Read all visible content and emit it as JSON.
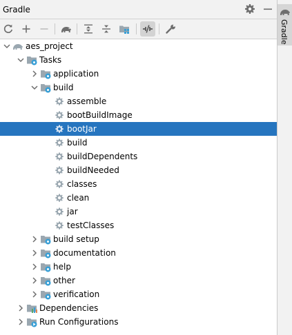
{
  "panel": {
    "title": "Gradle",
    "header_icons": [
      "gear-icon",
      "minimize-icon"
    ],
    "toolbar": [
      {
        "name": "reload-all-gradle-projects-button",
        "icon": "refresh-icon"
      },
      {
        "name": "add-gradle-project-button",
        "icon": "plus-icon"
      },
      {
        "name": "remove-gradle-project-button",
        "icon": "minus-icon",
        "enabled": false
      },
      {
        "name": "execute-gradle-task-button",
        "icon": "gradle-elephant-icon"
      },
      {
        "name": "expand-all-button",
        "icon": "expand-all-icon"
      },
      {
        "name": "collapse-all-button",
        "icon": "collapse-all-icon"
      },
      {
        "name": "analyze-dependencies-button",
        "icon": "dependencies-icon"
      },
      {
        "name": "toggle-offline-mode-button",
        "icon": "offline-mode-icon",
        "toggled": true
      },
      {
        "name": "build-tool-settings-button",
        "icon": "wrench-icon"
      }
    ]
  },
  "tree": {
    "selected_index": 6,
    "rows": [
      {
        "label": "aes_project",
        "depth": 0,
        "arrow": "expanded",
        "icon": "gradle-project-icon"
      },
      {
        "label": "Tasks",
        "depth": 1,
        "arrow": "expanded",
        "icon": "tasks-folder-icon"
      },
      {
        "label": "application",
        "depth": 2,
        "arrow": "collapsed",
        "icon": "task-group-icon"
      },
      {
        "label": "build",
        "depth": 2,
        "arrow": "expanded",
        "icon": "task-group-icon"
      },
      {
        "label": "assemble",
        "depth": 3,
        "arrow": "none",
        "icon": "gear-icon"
      },
      {
        "label": "bootBuildImage",
        "depth": 3,
        "arrow": "none",
        "icon": "gear-icon"
      },
      {
        "label": "bootJar",
        "depth": 3,
        "arrow": "none",
        "icon": "gear-icon"
      },
      {
        "label": "build",
        "depth": 3,
        "arrow": "none",
        "icon": "gear-icon"
      },
      {
        "label": "buildDependents",
        "depth": 3,
        "arrow": "none",
        "icon": "gear-icon"
      },
      {
        "label": "buildNeeded",
        "depth": 3,
        "arrow": "none",
        "icon": "gear-icon"
      },
      {
        "label": "classes",
        "depth": 3,
        "arrow": "none",
        "icon": "gear-icon"
      },
      {
        "label": "clean",
        "depth": 3,
        "arrow": "none",
        "icon": "gear-icon"
      },
      {
        "label": "jar",
        "depth": 3,
        "arrow": "none",
        "icon": "gear-icon"
      },
      {
        "label": "testClasses",
        "depth": 3,
        "arrow": "none",
        "icon": "gear-icon"
      },
      {
        "label": "build setup",
        "depth": 2,
        "arrow": "collapsed",
        "icon": "task-group-icon"
      },
      {
        "label": "documentation",
        "depth": 2,
        "arrow": "collapsed",
        "icon": "task-group-icon"
      },
      {
        "label": "help",
        "depth": 2,
        "arrow": "collapsed",
        "icon": "task-group-icon"
      },
      {
        "label": "other",
        "depth": 2,
        "arrow": "collapsed",
        "icon": "task-group-icon"
      },
      {
        "label": "verification",
        "depth": 2,
        "arrow": "collapsed",
        "icon": "task-group-icon"
      },
      {
        "label": "Dependencies",
        "depth": 1,
        "arrow": "collapsed",
        "icon": "dependencies-folder-icon"
      },
      {
        "label": "Run Configurations",
        "depth": 1,
        "arrow": "collapsed",
        "icon": "run-configurations-folder-icon"
      }
    ]
  },
  "side_stripe": {
    "label": "Gradle",
    "icon": "gradle-elephant-icon"
  },
  "colors": {
    "selection": "#2675bf",
    "folder": "#9aa7b0",
    "task_badge": "#389fd6",
    "gear": "#9aa7b0",
    "elephant": "#6e6e6e",
    "deps_bars": [
      "#59a869",
      "#389fd6",
      "#e08855"
    ]
  }
}
